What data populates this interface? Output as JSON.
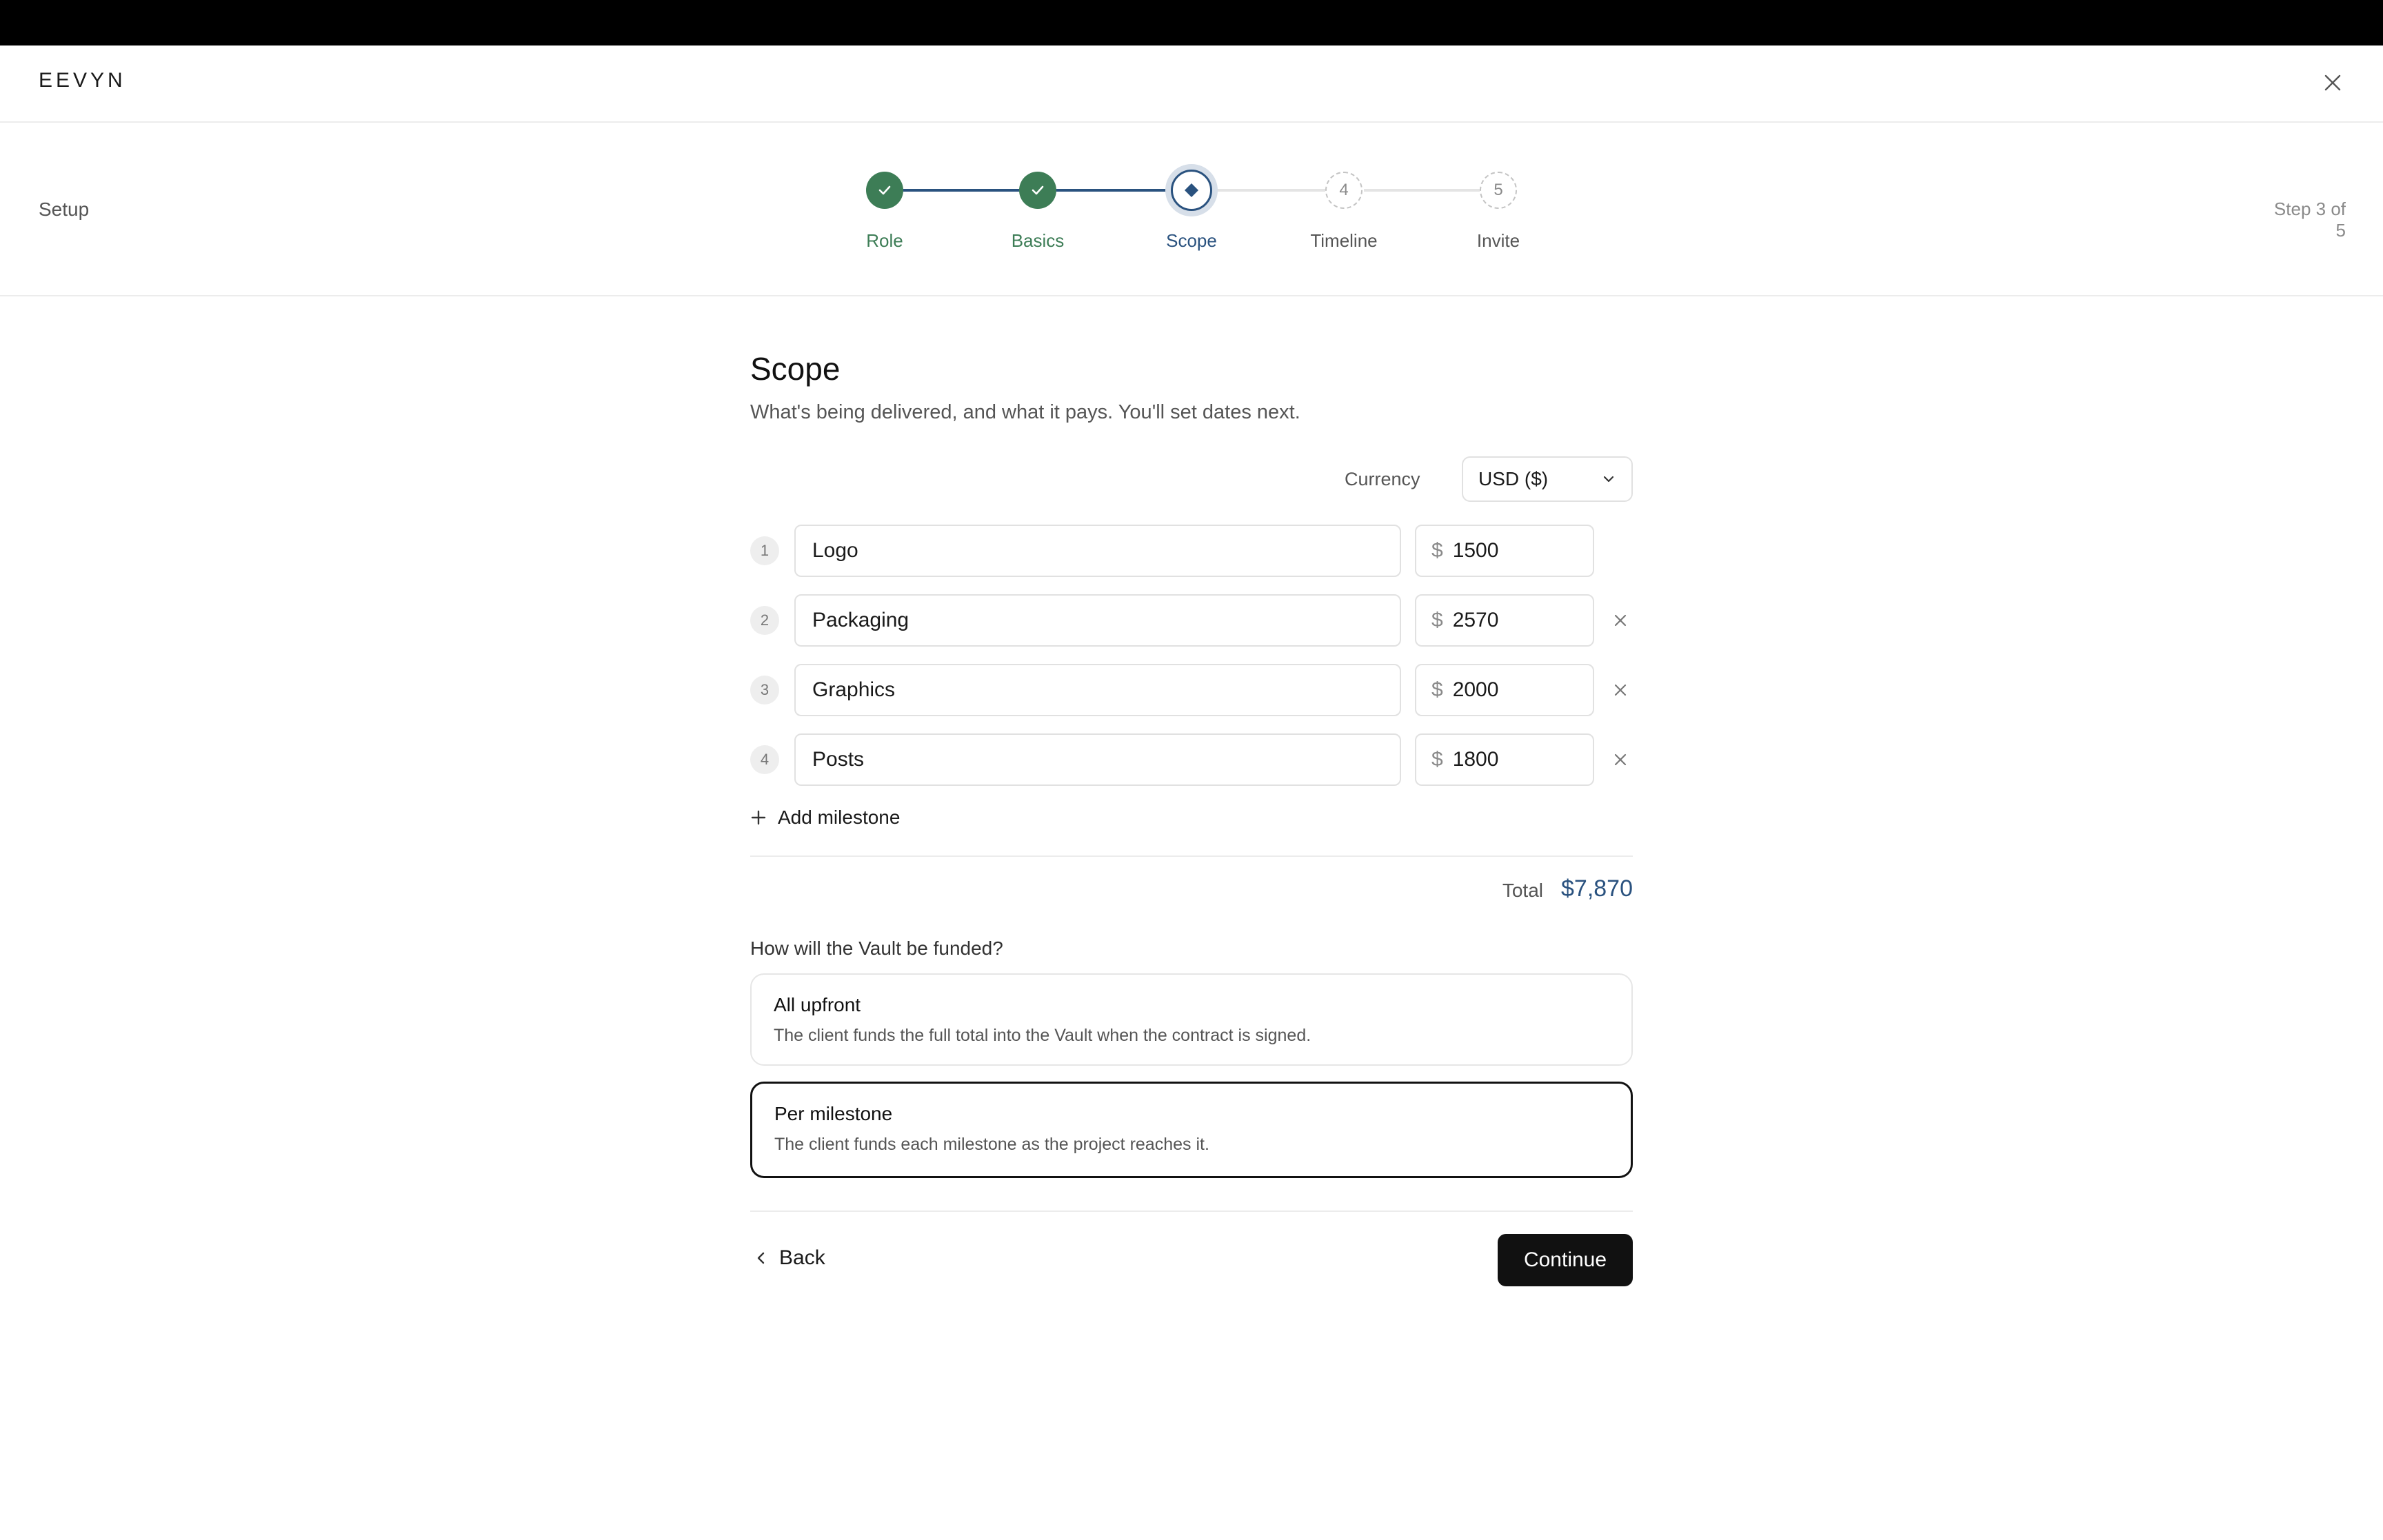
{
  "app": {
    "logo": "EEVYN"
  },
  "setup": {
    "label": "Setup",
    "step_count": "Step 3 of 5"
  },
  "stepper": {
    "steps": [
      {
        "label": "Role",
        "state": "done",
        "number": "1"
      },
      {
        "label": "Basics",
        "state": "done",
        "number": "2"
      },
      {
        "label": "Scope",
        "state": "current",
        "number": "3"
      },
      {
        "label": "Timeline",
        "state": "todo",
        "number": "4"
      },
      {
        "label": "Invite",
        "state": "todo",
        "number": "5"
      }
    ]
  },
  "page": {
    "title": "Scope",
    "subtitle": "What's being delivered, and what it pays. You'll set dates next."
  },
  "currency": {
    "label": "Currency",
    "value": "USD ($)"
  },
  "milestones": [
    {
      "number": "1",
      "name": "Logo",
      "currency_symbol": "$",
      "amount": "1500"
    },
    {
      "number": "2",
      "name": "Packaging",
      "currency_symbol": "$",
      "amount": "2570"
    },
    {
      "number": "3",
      "name": "Graphics",
      "currency_symbol": "$",
      "amount": "2000"
    },
    {
      "number": "4",
      "name": "Posts",
      "currency_symbol": "$",
      "amount": "1800"
    }
  ],
  "add_milestone_label": "Add milestone",
  "total": {
    "label": "Total",
    "value": "$7,870"
  },
  "funding": {
    "question": "How will the Vault be funded?",
    "options": [
      {
        "title": "All upfront",
        "description": "The client funds the full total into the Vault when the contract is signed.",
        "selected": false
      },
      {
        "title": "Per milestone",
        "description": "The client funds each milestone as the project reaches it.",
        "selected": true
      }
    ]
  },
  "nav": {
    "back_label": "Back",
    "continue_label": "Continue"
  },
  "colors": {
    "done": "#3d7d56",
    "current": "#2a527f",
    "accent_total": "#2a527f",
    "primary_button": "#111111"
  }
}
